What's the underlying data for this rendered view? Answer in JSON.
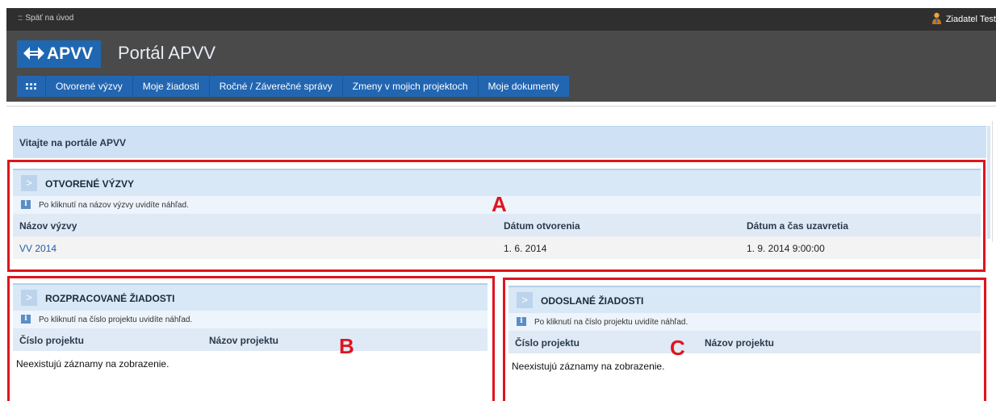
{
  "topbar": {
    "back_link": "Späť na úvod",
    "user_name": "Ziadatel Test"
  },
  "header": {
    "logo_text": "APVV",
    "title": "Portál APVV"
  },
  "nav": {
    "items": [
      {
        "label": "Otvorené výzvy"
      },
      {
        "label": "Moje žiadosti"
      },
      {
        "label": "Ročné / Záverečné správy"
      },
      {
        "label": "Zmeny v mojich projektoch"
      },
      {
        "label": "Moje dokumenty"
      }
    ]
  },
  "welcome": "Vitajte na portále APVV",
  "open_calls": {
    "title": "OTVORENÉ VÝZVY",
    "info": "Po kliknutí na názov výzvy uvidíte náhľad.",
    "columns": [
      "Názov výzvy",
      "Dátum otvorenia",
      "Dátum a čas uzavretia"
    ],
    "rows": [
      {
        "name": "VV 2014",
        "opened": "1. 6. 2014",
        "closes": "1. 9. 2014 9:00:00"
      }
    ]
  },
  "in_progress": {
    "title": "ROZPRACOVANÉ ŽIADOSTI",
    "info": "Po kliknutí na číslo projektu uvidíte náhľad.",
    "columns": [
      "Číslo projektu",
      "Názov projektu"
    ],
    "empty": "Neexistujú záznamy na zobrazenie."
  },
  "submitted": {
    "title": "ODOSLANÉ ŽIADOSTI",
    "info": "Po kliknutí na číslo projektu uvidíte náhľad.",
    "columns": [
      "Číslo projektu",
      "Názov projektu"
    ],
    "empty": "Neexistujú záznamy na zobrazenie."
  },
  "annotations": {
    "a": "A",
    "b": "B",
    "c": "C"
  },
  "colors": {
    "accent": "#2266b2",
    "annotation": "#e0141e",
    "header": "#4a4a4a"
  }
}
